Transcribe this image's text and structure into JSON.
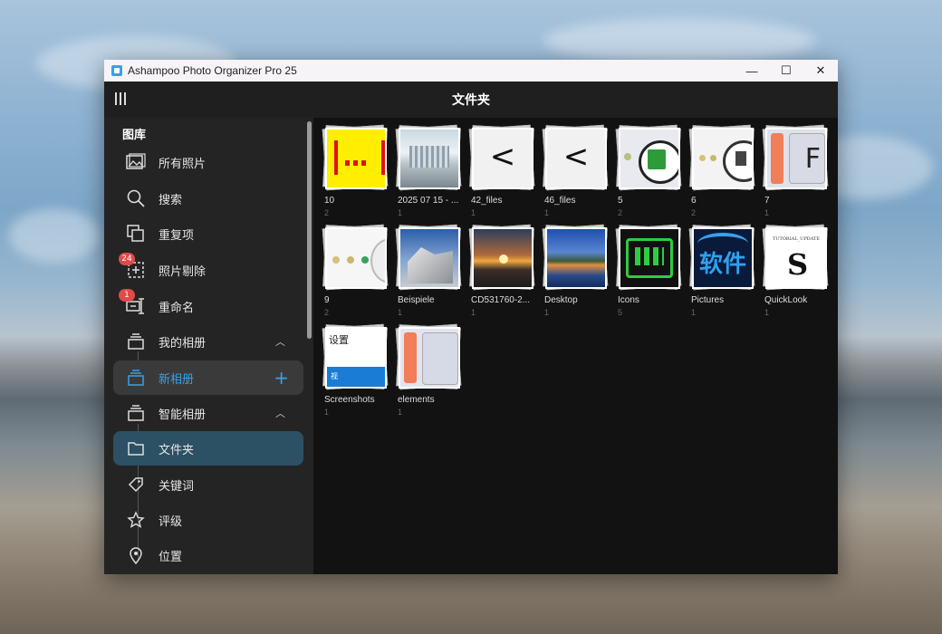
{
  "window": {
    "title": "Ashampoo Photo Organizer Pro 25",
    "minimize": "—",
    "maximize": "☐",
    "close": "✕"
  },
  "appbar": {
    "title": "文件夹"
  },
  "sidebar": {
    "section_title": "图库",
    "items": [
      {
        "label": "所有照片",
        "icon": "images-icon"
      },
      {
        "label": "搜索",
        "icon": "search-icon"
      },
      {
        "label": "重复项",
        "icon": "duplicate-icon"
      },
      {
        "label": "照片剔除",
        "icon": "photo-cull-icon",
        "badge": "24"
      },
      {
        "label": "重命名",
        "icon": "rename-icon",
        "badge": "1"
      },
      {
        "label": "我的相册",
        "icon": "album-icon",
        "chevron": "︿"
      },
      {
        "label": "新相册",
        "icon": "album-icon",
        "plus": "+"
      },
      {
        "label": "智能相册",
        "icon": "smart-album-icon",
        "chevron": "︿"
      },
      {
        "label": "文件夹",
        "icon": "folder-icon"
      },
      {
        "label": "关键词",
        "icon": "tag-icon"
      },
      {
        "label": "评级",
        "icon": "star-icon"
      },
      {
        "label": "位置",
        "icon": "location-icon"
      }
    ]
  },
  "folders": [
    {
      "name": "10",
      "count": "2",
      "thumb": "yellow-red"
    },
    {
      "name": "2025 07 15 - ...",
      "count": "1",
      "thumb": "city"
    },
    {
      "name": "42_files",
      "count": "1",
      "thumb": "lt"
    },
    {
      "name": "46_files",
      "count": "1",
      "thumb": "lt"
    },
    {
      "name": "5",
      "count": "2",
      "thumb": "clipboard"
    },
    {
      "name": "6",
      "count": "2",
      "thumb": "doc"
    },
    {
      "name": "7",
      "count": "1",
      "thumb": "F"
    },
    {
      "name": "9",
      "count": "2",
      "thumb": "dots"
    },
    {
      "name": "Beispiele",
      "count": "1",
      "thumb": "building"
    },
    {
      "name": "CD531760-2...",
      "count": "1",
      "thumb": "sunset"
    },
    {
      "name": "Desktop",
      "count": "1",
      "thumb": "lake"
    },
    {
      "name": "Icons",
      "count": "5",
      "thumb": "greenbox"
    },
    {
      "name": "Pictures",
      "count": "1",
      "thumb": "ruanjian"
    },
    {
      "name": "QuickLook",
      "count": "1",
      "thumb": "doc-s"
    },
    {
      "name": "Screenshots",
      "count": "1",
      "thumb": "settings"
    },
    {
      "name": "elements",
      "count": "1",
      "thumb": "pink"
    }
  ],
  "thumb_texts": {
    "F": "F",
    "lt": "<",
    "ruanjian": "软件",
    "settings_top": "设置",
    "settings_bottom": "视",
    "quicklook_line": "TUTORIAL_UPDATE",
    "quicklook_s": "S"
  }
}
